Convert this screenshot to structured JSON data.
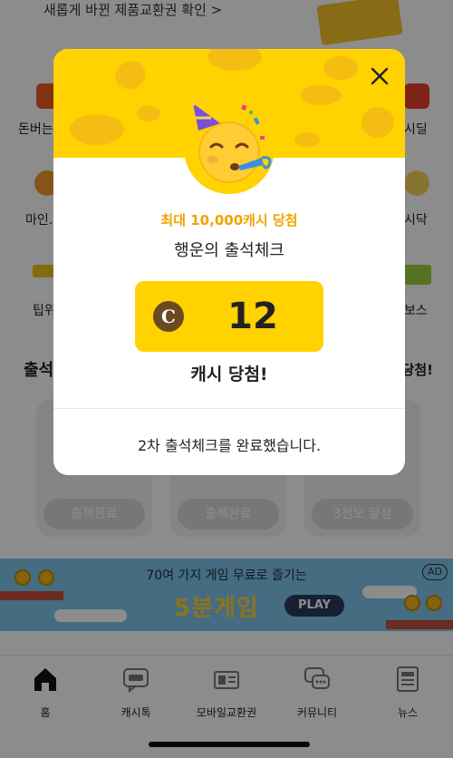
{
  "top_banner": {
    "text": "새롭게 바뀐 제품교환권 확인 >"
  },
  "side_labels": {
    "row1_left": "돈버는",
    "row1_right": "시딜",
    "row2_left": "마인.",
    "row2_right": "시닥",
    "row3_left": "팁위",
    "row3_right": "보스"
  },
  "section": {
    "title": "출석",
    "right": "당첨!"
  },
  "cards": [
    {
      "label": "출첵완료"
    },
    {
      "label": "출첵완료"
    },
    {
      "label": "3천보 달성"
    }
  ],
  "ad": {
    "line1": "70여 가지 게임 무료로 즐기는",
    "game": "5분게임",
    "play": "PLAY",
    "badge": "AD"
  },
  "tabbar": {
    "tabs": [
      {
        "label": "홈",
        "icon": "home-icon"
      },
      {
        "label": "캐시톡",
        "icon": "talk-icon"
      },
      {
        "label": "모바일교환권",
        "icon": "voucher-icon"
      },
      {
        "label": "커뮤니티",
        "icon": "community-icon"
      },
      {
        "label": "뉴스",
        "icon": "news-icon"
      }
    ]
  },
  "modal": {
    "emoji": "partying-face-icon",
    "prize_caption": "최대 10,000캐시 당첨",
    "title": "행운의 출석체크",
    "cash_symbol": "C",
    "cash_value": "12",
    "won_text": "캐시 당첨!",
    "done_text": "2차 출석체크를 완료했습니다.",
    "accent_color": "#FFD200"
  }
}
